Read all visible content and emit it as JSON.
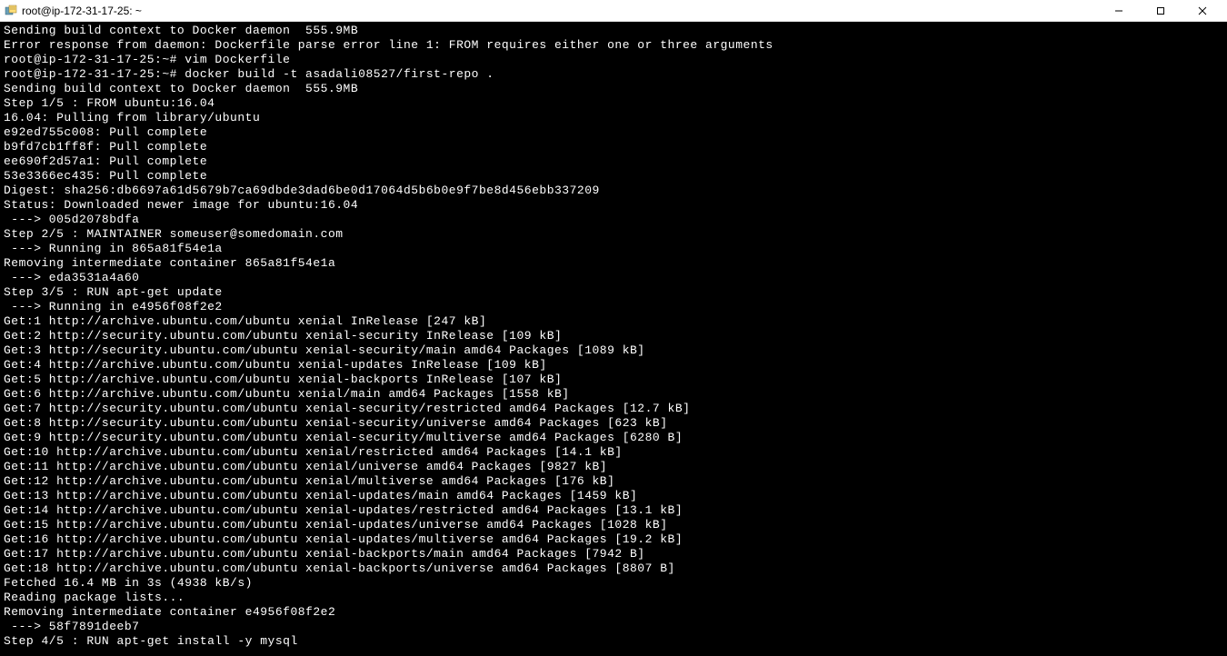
{
  "window": {
    "title": "root@ip-172-31-17-25: ~"
  },
  "terminal": {
    "lines": [
      "Sending build context to Docker daemon  555.9MB",
      "Error response from daemon: Dockerfile parse error line 1: FROM requires either one or three arguments",
      "root@ip-172-31-17-25:~# vim Dockerfile",
      "root@ip-172-31-17-25:~# docker build -t asadali08527/first-repo .",
      "Sending build context to Docker daemon  555.9MB",
      "Step 1/5 : FROM ubuntu:16.04",
      "16.04: Pulling from library/ubuntu",
      "e92ed755c008: Pull complete",
      "b9fd7cb1ff8f: Pull complete",
      "ee690f2d57a1: Pull complete",
      "53e3366ec435: Pull complete",
      "Digest: sha256:db6697a61d5679b7ca69dbde3dad6be0d17064d5b6b0e9f7be8d456ebb337209",
      "Status: Downloaded newer image for ubuntu:16.04",
      " ---> 005d2078bdfa",
      "Step 2/5 : MAINTAINER someuser@somedomain.com",
      " ---> Running in 865a81f54e1a",
      "Removing intermediate container 865a81f54e1a",
      " ---> eda3531a4a60",
      "Step 3/5 : RUN apt-get update",
      " ---> Running in e4956f08f2e2",
      "Get:1 http://archive.ubuntu.com/ubuntu xenial InRelease [247 kB]",
      "Get:2 http://security.ubuntu.com/ubuntu xenial-security InRelease [109 kB]",
      "Get:3 http://security.ubuntu.com/ubuntu xenial-security/main amd64 Packages [1089 kB]",
      "Get:4 http://archive.ubuntu.com/ubuntu xenial-updates InRelease [109 kB]",
      "Get:5 http://archive.ubuntu.com/ubuntu xenial-backports InRelease [107 kB]",
      "Get:6 http://archive.ubuntu.com/ubuntu xenial/main amd64 Packages [1558 kB]",
      "Get:7 http://security.ubuntu.com/ubuntu xenial-security/restricted amd64 Packages [12.7 kB]",
      "Get:8 http://security.ubuntu.com/ubuntu xenial-security/universe amd64 Packages [623 kB]",
      "Get:9 http://security.ubuntu.com/ubuntu xenial-security/multiverse amd64 Packages [6280 B]",
      "Get:10 http://archive.ubuntu.com/ubuntu xenial/restricted amd64 Packages [14.1 kB]",
      "Get:11 http://archive.ubuntu.com/ubuntu xenial/universe amd64 Packages [9827 kB]",
      "Get:12 http://archive.ubuntu.com/ubuntu xenial/multiverse amd64 Packages [176 kB]",
      "Get:13 http://archive.ubuntu.com/ubuntu xenial-updates/main amd64 Packages [1459 kB]",
      "Get:14 http://archive.ubuntu.com/ubuntu xenial-updates/restricted amd64 Packages [13.1 kB]",
      "Get:15 http://archive.ubuntu.com/ubuntu xenial-updates/universe amd64 Packages [1028 kB]",
      "Get:16 http://archive.ubuntu.com/ubuntu xenial-updates/multiverse amd64 Packages [19.2 kB]",
      "Get:17 http://archive.ubuntu.com/ubuntu xenial-backports/main amd64 Packages [7942 B]",
      "Get:18 http://archive.ubuntu.com/ubuntu xenial-backports/universe amd64 Packages [8807 B]",
      "Fetched 16.4 MB in 3s (4938 kB/s)",
      "Reading package lists...",
      "Removing intermediate container e4956f08f2e2",
      " ---> 58f7891deeb7",
      "Step 4/5 : RUN apt-get install -y mysql"
    ]
  }
}
